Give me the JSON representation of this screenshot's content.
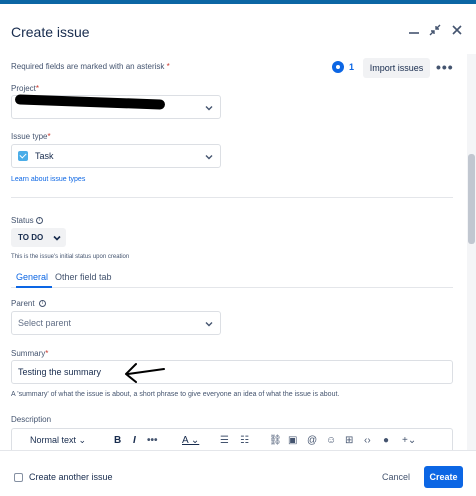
{
  "dialog": {
    "title": "Create issue",
    "required_notice": "Required fields are marked with an asterisk",
    "asterisk": "*",
    "watch_count": "1",
    "import_label": "Import issues",
    "more_label": "•••"
  },
  "project": {
    "label": "Project",
    "value": ""
  },
  "issue_type": {
    "label": "Issue type",
    "value": "Task",
    "icon": "task-checkbox-icon",
    "link": "Learn about issue types"
  },
  "status": {
    "label": "Status",
    "value": "TO DO",
    "help": "This is the issue's initial status upon creation"
  },
  "tabs": [
    {
      "label": "General"
    },
    {
      "label": "Other field tab"
    }
  ],
  "parent": {
    "label": "Parent",
    "placeholder": "Select parent"
  },
  "summary": {
    "label": "Summary",
    "value": "Testing the summary",
    "help": "A 'summary' of what the issue is about, a short phrase to give everyone an idea of what the issue is about."
  },
  "description": {
    "label": "Description",
    "text_style": "Normal text"
  },
  "footer": {
    "create_another": "Create another issue",
    "cancel": "Cancel",
    "create": "Create"
  },
  "colors": {
    "accent": "#0c66e4",
    "required": "#c9372c",
    "task": "#4bade8"
  }
}
